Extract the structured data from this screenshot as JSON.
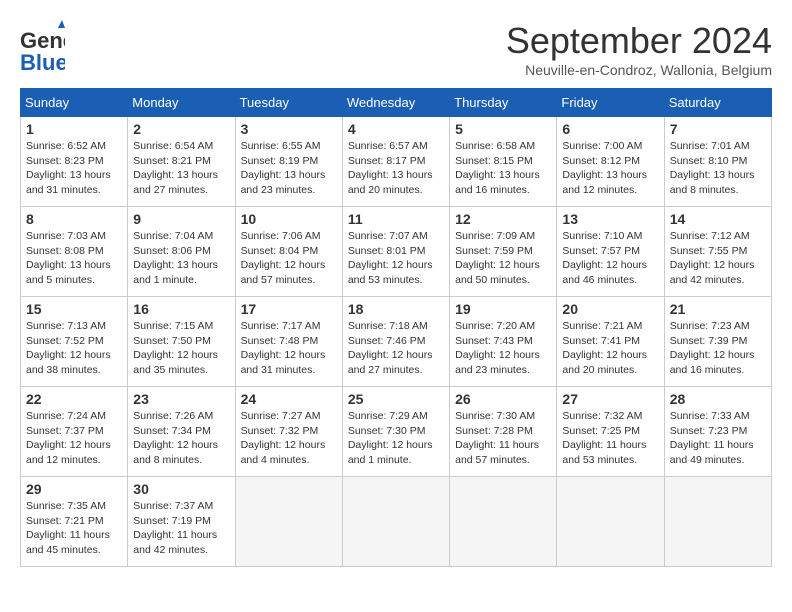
{
  "header": {
    "logo_general": "General",
    "logo_blue": "Blue",
    "title": "September 2024",
    "subtitle": "Neuville-en-Condroz, Wallonia, Belgium"
  },
  "calendar": {
    "headers": [
      "Sunday",
      "Monday",
      "Tuesday",
      "Wednesday",
      "Thursday",
      "Friday",
      "Saturday"
    ],
    "weeks": [
      [
        {
          "day": "",
          "empty": true
        },
        {
          "day": "",
          "empty": true
        },
        {
          "day": "",
          "empty": true
        },
        {
          "day": "",
          "empty": true
        },
        {
          "day": "",
          "empty": true
        },
        {
          "day": "",
          "empty": true
        },
        {
          "day": "7",
          "info": "Sunrise: 7:01 AM\nSunset: 8:10 PM\nDaylight: 13 hours\nand 8 minutes."
        }
      ],
      [
        {
          "day": "1",
          "info": "Sunrise: 6:52 AM\nSunset: 8:23 PM\nDaylight: 13 hours\nand 31 minutes."
        },
        {
          "day": "2",
          "info": "Sunrise: 6:54 AM\nSunset: 8:21 PM\nDaylight: 13 hours\nand 27 minutes."
        },
        {
          "day": "3",
          "info": "Sunrise: 6:55 AM\nSunset: 8:19 PM\nDaylight: 13 hours\nand 23 minutes."
        },
        {
          "day": "4",
          "info": "Sunrise: 6:57 AM\nSunset: 8:17 PM\nDaylight: 13 hours\nand 20 minutes."
        },
        {
          "day": "5",
          "info": "Sunrise: 6:58 AM\nSunset: 8:15 PM\nDaylight: 13 hours\nand 16 minutes."
        },
        {
          "day": "6",
          "info": "Sunrise: 7:00 AM\nSunset: 8:12 PM\nDaylight: 13 hours\nand 12 minutes."
        },
        {
          "day": "7",
          "info": "Sunrise: 7:01 AM\nSunset: 8:10 PM\nDaylight: 13 hours\nand 8 minutes."
        }
      ],
      [
        {
          "day": "8",
          "info": "Sunrise: 7:03 AM\nSunset: 8:08 PM\nDaylight: 13 hours\nand 5 minutes."
        },
        {
          "day": "9",
          "info": "Sunrise: 7:04 AM\nSunset: 8:06 PM\nDaylight: 13 hours\nand 1 minute."
        },
        {
          "day": "10",
          "info": "Sunrise: 7:06 AM\nSunset: 8:04 PM\nDaylight: 12 hours\nand 57 minutes."
        },
        {
          "day": "11",
          "info": "Sunrise: 7:07 AM\nSunset: 8:01 PM\nDaylight: 12 hours\nand 53 minutes."
        },
        {
          "day": "12",
          "info": "Sunrise: 7:09 AM\nSunset: 7:59 PM\nDaylight: 12 hours\nand 50 minutes."
        },
        {
          "day": "13",
          "info": "Sunrise: 7:10 AM\nSunset: 7:57 PM\nDaylight: 12 hours\nand 46 minutes."
        },
        {
          "day": "14",
          "info": "Sunrise: 7:12 AM\nSunset: 7:55 PM\nDaylight: 12 hours\nand 42 minutes."
        }
      ],
      [
        {
          "day": "15",
          "info": "Sunrise: 7:13 AM\nSunset: 7:52 PM\nDaylight: 12 hours\nand 38 minutes."
        },
        {
          "day": "16",
          "info": "Sunrise: 7:15 AM\nSunset: 7:50 PM\nDaylight: 12 hours\nand 35 minutes."
        },
        {
          "day": "17",
          "info": "Sunrise: 7:17 AM\nSunset: 7:48 PM\nDaylight: 12 hours\nand 31 minutes."
        },
        {
          "day": "18",
          "info": "Sunrise: 7:18 AM\nSunset: 7:46 PM\nDaylight: 12 hours\nand 27 minutes."
        },
        {
          "day": "19",
          "info": "Sunrise: 7:20 AM\nSunset: 7:43 PM\nDaylight: 12 hours\nand 23 minutes."
        },
        {
          "day": "20",
          "info": "Sunrise: 7:21 AM\nSunset: 7:41 PM\nDaylight: 12 hours\nand 20 minutes."
        },
        {
          "day": "21",
          "info": "Sunrise: 7:23 AM\nSunset: 7:39 PM\nDaylight: 12 hours\nand 16 minutes."
        }
      ],
      [
        {
          "day": "22",
          "info": "Sunrise: 7:24 AM\nSunset: 7:37 PM\nDaylight: 12 hours\nand 12 minutes."
        },
        {
          "day": "23",
          "info": "Sunrise: 7:26 AM\nSunset: 7:34 PM\nDaylight: 12 hours\nand 8 minutes."
        },
        {
          "day": "24",
          "info": "Sunrise: 7:27 AM\nSunset: 7:32 PM\nDaylight: 12 hours\nand 4 minutes."
        },
        {
          "day": "25",
          "info": "Sunrise: 7:29 AM\nSunset: 7:30 PM\nDaylight: 12 hours\nand 1 minute."
        },
        {
          "day": "26",
          "info": "Sunrise: 7:30 AM\nSunset: 7:28 PM\nDaylight: 11 hours\nand 57 minutes."
        },
        {
          "day": "27",
          "info": "Sunrise: 7:32 AM\nSunset: 7:25 PM\nDaylight: 11 hours\nand 53 minutes."
        },
        {
          "day": "28",
          "info": "Sunrise: 7:33 AM\nSunset: 7:23 PM\nDaylight: 11 hours\nand 49 minutes."
        }
      ],
      [
        {
          "day": "29",
          "info": "Sunrise: 7:35 AM\nSunset: 7:21 PM\nDaylight: 11 hours\nand 45 minutes."
        },
        {
          "day": "30",
          "info": "Sunrise: 7:37 AM\nSunset: 7:19 PM\nDaylight: 11 hours\nand 42 minutes."
        },
        {
          "day": "",
          "empty": true
        },
        {
          "day": "",
          "empty": true
        },
        {
          "day": "",
          "empty": true
        },
        {
          "day": "",
          "empty": true
        },
        {
          "day": "",
          "empty": true
        }
      ]
    ]
  }
}
